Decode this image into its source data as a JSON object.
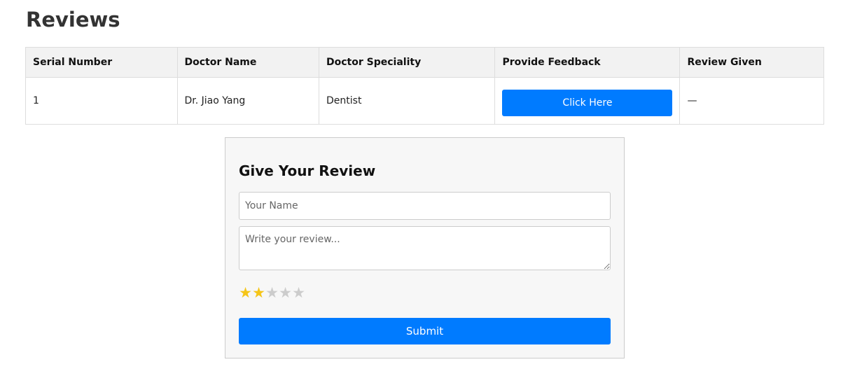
{
  "page": {
    "title": "Reviews"
  },
  "table": {
    "headers": [
      "Serial Number",
      "Doctor Name",
      "Doctor Speciality",
      "Provide Feedback",
      "Review Given"
    ],
    "rows": [
      {
        "serial": "1",
        "doctor": "Dr. Jiao Yang",
        "speciality": "Dentist",
        "feedback_button": "Click Here",
        "review_given": "—"
      }
    ]
  },
  "review_form": {
    "title": "Give Your Review",
    "name_placeholder": "Your Name",
    "review_placeholder": "Write your review...",
    "rating": 2,
    "rating_max": 5,
    "star_glyph": "★",
    "submit_label": "Submit"
  },
  "colors": {
    "accent": "#007bff",
    "star_filled": "#f5c518",
    "star_empty": "#cccccc"
  }
}
